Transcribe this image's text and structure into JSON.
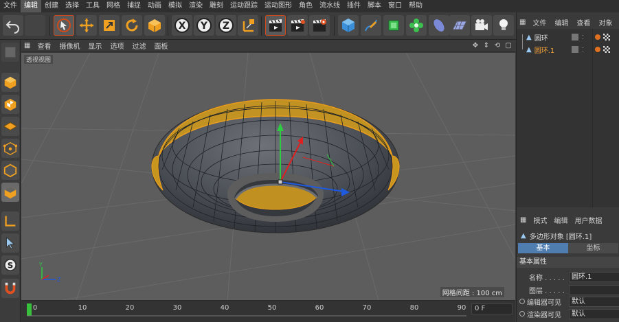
{
  "menubar": {
    "items": [
      "文件",
      "编辑",
      "创建",
      "选择",
      "工具",
      "网格",
      "捕捉",
      "动画",
      "模拟",
      "渲染",
      "雕刻",
      "运动跟踪",
      "运动图形",
      "角色",
      "流水线",
      "插件",
      "脚本",
      "窗口",
      "帮助"
    ],
    "active_index": 1
  },
  "viewport_menu": {
    "items": [
      "查看",
      "摄像机",
      "显示",
      "选项",
      "过滤",
      "面板"
    ]
  },
  "viewport": {
    "view_name": "透视视图",
    "grid_spacing": "网格间距 : 100 cm",
    "bg_color": "#5d5d5d",
    "selection_color": "#f2a21c",
    "axis_labels": {
      "y": "Y",
      "z": "Z"
    }
  },
  "timeline": {
    "ticks": [
      "0",
      "10",
      "20",
      "30",
      "40",
      "50",
      "60",
      "70",
      "80",
      "90"
    ],
    "current_frame": "0 F"
  },
  "object_manager": {
    "tabs": [
      "文件",
      "编辑",
      "查看",
      "对象"
    ],
    "objects": [
      {
        "name": "圆环",
        "selected": false
      },
      {
        "name": "圆环.1",
        "selected": true
      }
    ]
  },
  "attribute_manager": {
    "tabs": [
      "模式",
      "编辑",
      "用户数据"
    ],
    "title": "多边形对象 [圆环.1]",
    "mode_tabs": [
      {
        "label": "基本",
        "active": true
      },
      {
        "label": "坐标",
        "active": false
      }
    ],
    "section": "基本属性",
    "fields": [
      {
        "label": "名称 . . . . .",
        "value": "圆环.1"
      },
      {
        "label": "图层 . . . . .",
        "value": ""
      },
      {
        "label": "编辑器可见",
        "value": "默认"
      },
      {
        "label": "渲染器可见",
        "value": "默认"
      }
    ]
  },
  "colors": {
    "accent_blue": "#4f7db0",
    "highlight_orange": "#f2a03a"
  }
}
